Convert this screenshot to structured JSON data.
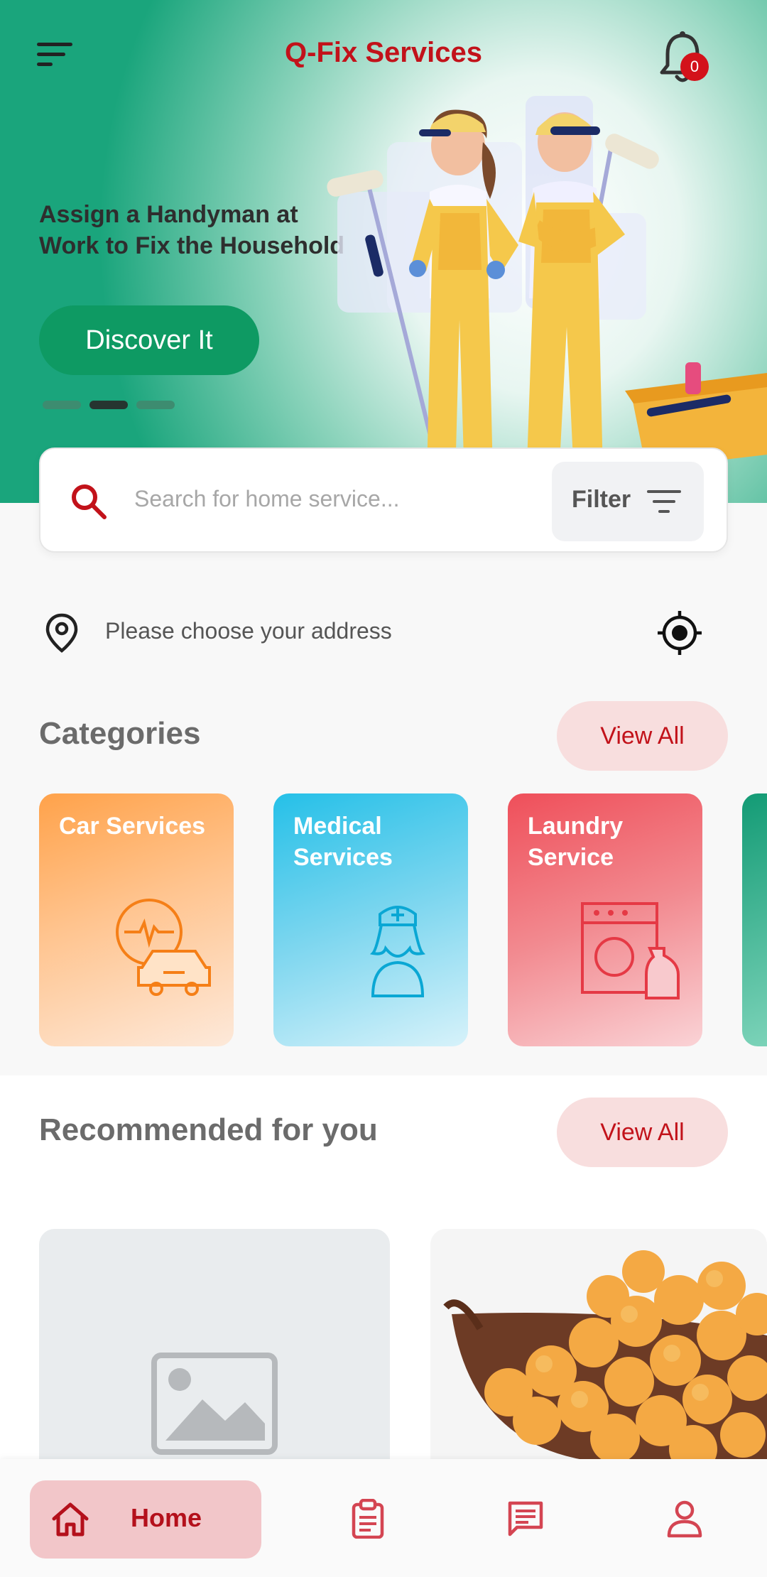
{
  "header": {
    "app_title": "Q-Fix Services",
    "notification_count": "0"
  },
  "hero": {
    "headline": "Assign a Handyman at Work to Fix the Household",
    "cta_label": "Discover It",
    "carousel_active_index": 1,
    "carousel_total": 3
  },
  "search": {
    "placeholder": "Search for home service...",
    "filter_label": "Filter"
  },
  "address": {
    "text": "Please choose your address"
  },
  "categories": {
    "title": "Categories",
    "view_all": "View All",
    "items": [
      {
        "label": "Car Services",
        "icon": "car-service-icon"
      },
      {
        "label": "Medical Services",
        "icon": "nurse-icon"
      },
      {
        "label": "Laundry Service",
        "icon": "washing-machine-icon"
      }
    ]
  },
  "recommended": {
    "title": "Recommended for you",
    "view_all": "View All"
  },
  "bottom_nav": {
    "home_label": "Home",
    "items": [
      "home-icon",
      "orders-icon",
      "chat-icon",
      "profile-icon"
    ]
  },
  "colors": {
    "brand_red": "#c2121a",
    "brand_green": "#0e9a63"
  }
}
